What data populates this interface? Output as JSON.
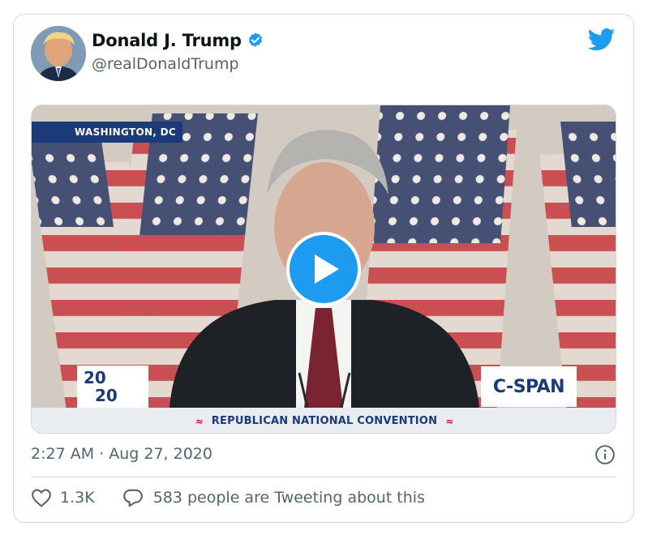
{
  "tweet": {
    "author": {
      "display_name": "Donald J. Trump",
      "handle": "@realDonaldTrump",
      "verified": true
    },
    "media": {
      "type": "video",
      "location_banner": "WASHINGTON, DC",
      "event_logo_line1": "20",
      "event_logo_line2": "20",
      "network_logo": "C-SPAN",
      "lower_third": "REPUBLICAN NATIONAL CONVENTION"
    },
    "timestamp": "2:27 AM · Aug 27, 2020",
    "like_count": "1.3K",
    "conversation_text": "583 people are Tweeting about this"
  },
  "colors": {
    "accent": "#1d9bf0",
    "text_primary": "#0f1419",
    "text_secondary": "#536471",
    "border": "#cfd9de"
  },
  "icons": {
    "verified": "verified-badge-icon",
    "brand": "twitter-bird-icon",
    "play": "play-icon",
    "info": "info-icon",
    "like": "heart-icon",
    "reply": "reply-bubble-icon"
  }
}
